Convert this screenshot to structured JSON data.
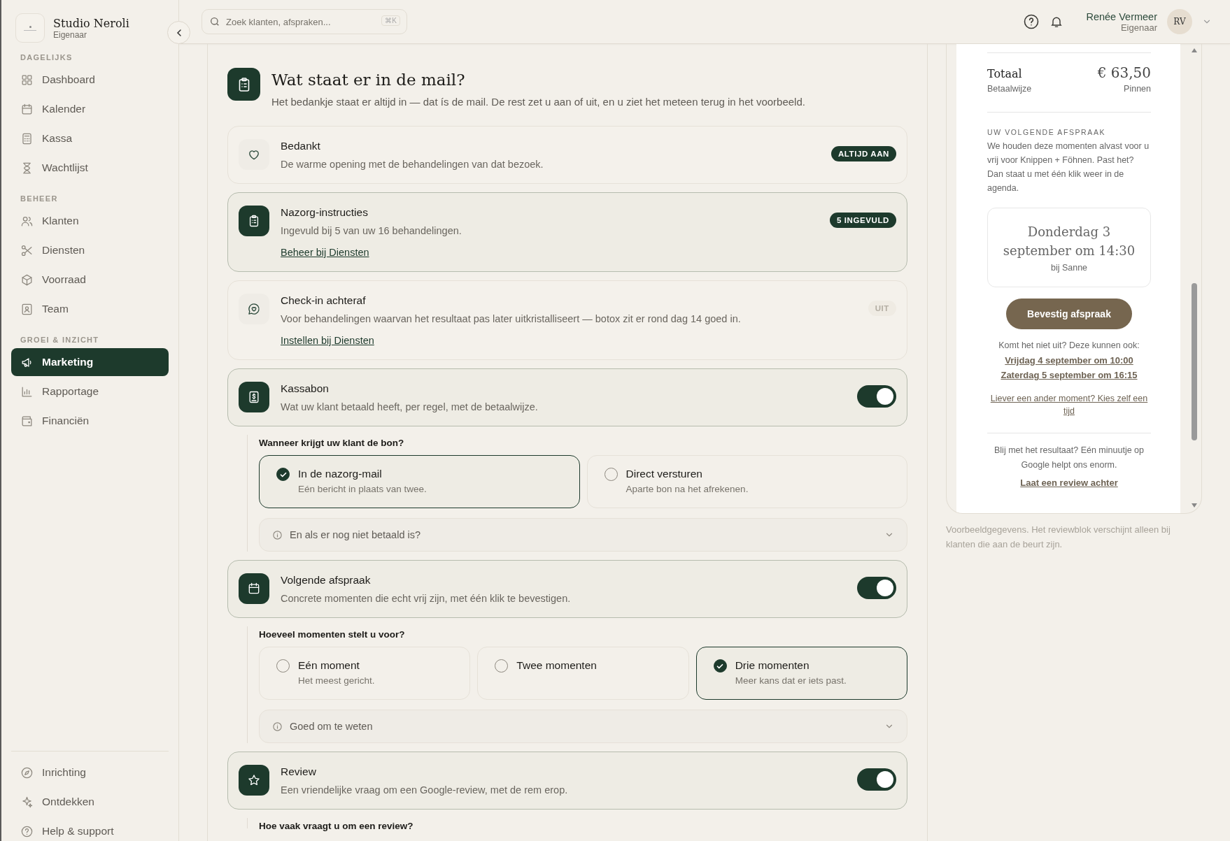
{
  "sidebar": {
    "brand": {
      "name": "Studio Neroli",
      "role": "Eigenaar"
    },
    "sections": [
      {
        "heading": "DAGELIJKS",
        "items": [
          {
            "label": "Dashboard",
            "selected": false
          },
          {
            "label": "Kalender",
            "selected": false
          },
          {
            "label": "Kassa",
            "selected": false
          },
          {
            "label": "Wachtlijst",
            "selected": false
          }
        ]
      },
      {
        "heading": "BEHEER",
        "items": [
          {
            "label": "Klanten",
            "selected": false
          },
          {
            "label": "Diensten",
            "selected": false
          },
          {
            "label": "Voorraad",
            "selected": false
          },
          {
            "label": "Team",
            "selected": false
          }
        ]
      },
      {
        "heading": "GROEI & INZICHT",
        "items": [
          {
            "label": "Marketing",
            "selected": true
          },
          {
            "label": "Rapportage",
            "selected": false
          },
          {
            "label": "Financiën",
            "selected": false
          }
        ]
      }
    ],
    "footer_items": [
      {
        "label": "Inrichting",
        "selected": false
      },
      {
        "label": "Ontdekken",
        "selected": false
      },
      {
        "label": "Help & support",
        "selected": false
      }
    ]
  },
  "header": {
    "search": {
      "placeholder": "Zoek klanten, afspraken...",
      "shortcut": "⌘K"
    },
    "user": {
      "name": "Renée Vermeer",
      "role": "Eigenaar",
      "initials": "RV"
    }
  },
  "main": {
    "title": "Wat staat er in de mail?",
    "subtitle": "Het bedankje staat er altijd in — dat ís de mail. De rest zet u aan of uit, en u ziet het meteen terug in het voorbeeld.",
    "blocks": [
      {
        "kind": "badge",
        "title": "Bedankt",
        "description": "De warme opening met de behandelingen van dat bezoek.",
        "active": false,
        "badge": "ALTIJD AAN",
        "badge_on": true
      },
      {
        "kind": "badge",
        "title": "Nazorg-instructies",
        "description": "Ingevuld bij 5 van uw 16 behandelingen.",
        "active": true,
        "badge": "5 INGEVULD",
        "badge_on": true,
        "link": "Beheer bij Diensten"
      },
      {
        "kind": "badge",
        "title": "Check-in achteraf",
        "description": "Voor behandelingen waarvan het resultaat pas later uitkristalliseert — botox zit er rond dag 14 goed in.",
        "active": false,
        "badge": "UIT",
        "badge_on": false,
        "link": "Instellen bij Diensten"
      },
      {
        "kind": "toggle",
        "title": "Kassabon",
        "description": "Wat uw klant betaald heeft, per regel, met de betaalwijze.",
        "on": true,
        "options": {
          "question": "Wanneer krijgt uw klant de bon?",
          "choices": [
            {
              "title": "In de nazorg-mail",
              "description": "Eén bericht in plaats van twee.",
              "selected": true
            },
            {
              "title": "Direct versturen",
              "description": "Aparte bon na het afrekenen.",
              "selected": false
            }
          ],
          "disclosure": "En als er nog niet betaald is?",
          "expanded": false
        }
      },
      {
        "kind": "toggle",
        "title": "Volgende afspraak",
        "description": "Concrete momenten die echt vrij zijn, met één klik te bevestigen.",
        "on": true,
        "options": {
          "question": "Hoeveel momenten stelt u voor?",
          "choices": [
            {
              "title": "Eén moment",
              "description": "Het meest gericht.",
              "selected": false
            },
            {
              "title": "Twee momenten",
              "selected": false
            },
            {
              "title": "Drie momenten",
              "description": "Meer kans dat er iets past.",
              "selected": true
            }
          ],
          "disclosure": "Goed om te weten",
          "expanded": false
        }
      },
      {
        "kind": "toggle",
        "title": "Review",
        "description": "Een vriendelijke vraag om een Google-review, met de rem erop.",
        "on": true,
        "options": {
          "question": "Hoe vaak vraagt u om een review?"
        }
      }
    ]
  },
  "preview": {
    "total_label": "Totaal",
    "total_value": "€ 63,50",
    "method_label": "Betaalwijze",
    "method_value": "Pinnen",
    "section_heading": "UW VOLGENDE AFSPRAAK",
    "section_text": "We houden deze momenten alvast voor u vrij voor Knippen + Föhnen. Past het? Dan staat u met één klik weer in de agenda.",
    "slot": {
      "date": "Donderdag 3 september om 14:30",
      "staff": "bij Sanne"
    },
    "confirm_button": "Bevestig afspraak",
    "alt_intro": "Komt het niet uit? Deze kunnen ook:",
    "alt_slots": [
      "Vrijdag 4 september om 10:00",
      "Zaterdag 5 september om 16:15"
    ],
    "other_link": "Liever een ander moment? Kies zelf een tijd",
    "review_text": "Blij met het resultaat? Eén minuutje op Google helpt ons enorm.",
    "review_link": "Laat een review achter",
    "caption": "Voorbeeldgegevens. Het reviewblok verschijnt alleen bij klanten die aan de beurt zijn."
  }
}
